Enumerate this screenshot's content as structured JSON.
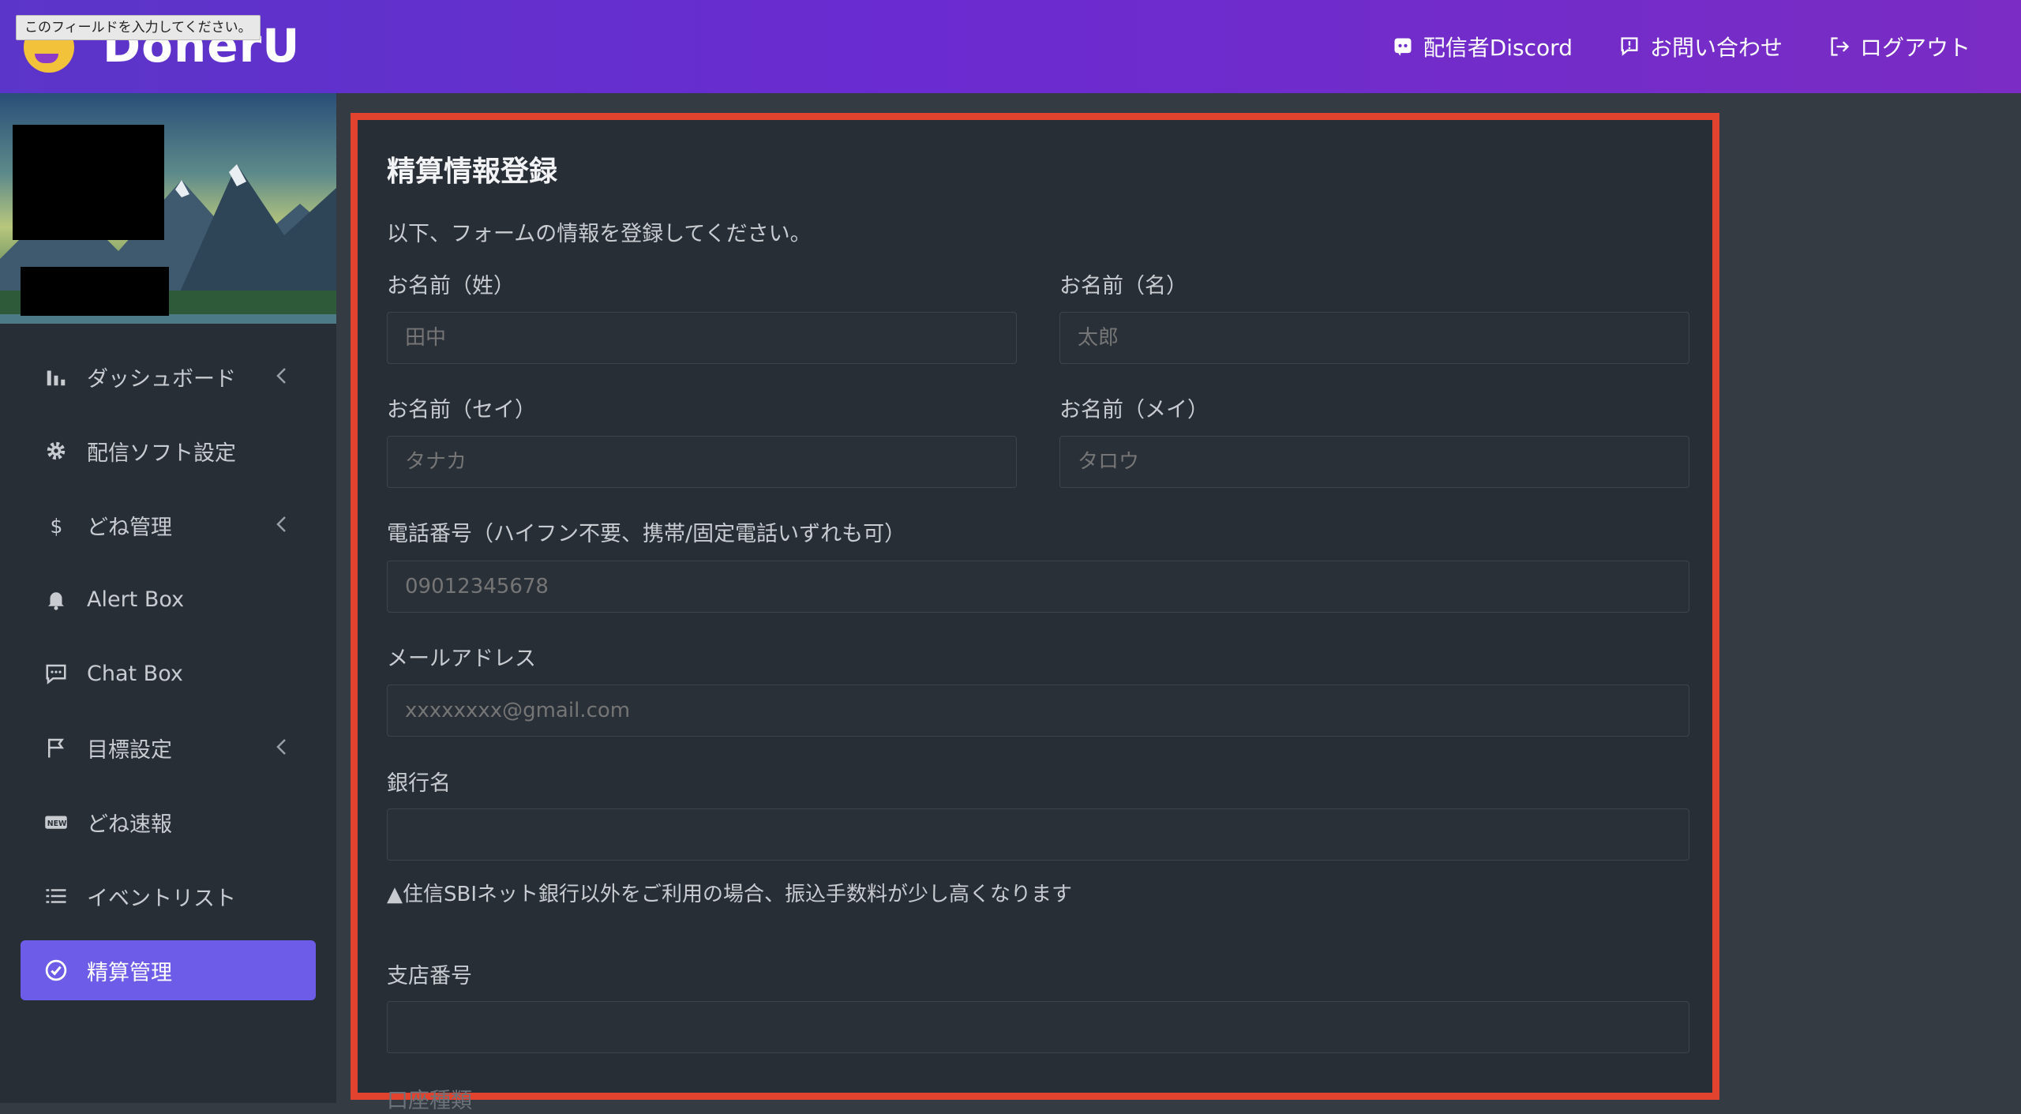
{
  "tooltip": "このフィールドを入力してください。",
  "brand": {
    "name": "DonerU"
  },
  "header_nav": [
    {
      "label": "配信者Discord",
      "icon": "discord-icon"
    },
    {
      "label": "お問い合わせ",
      "icon": "chat-alert-icon"
    },
    {
      "label": "ログアウト",
      "icon": "logout-icon"
    }
  ],
  "sidebar": {
    "items": [
      {
        "label": "ダッシュボード",
        "icon": "bar-chart-icon",
        "chevron": true
      },
      {
        "label": "配信ソフト設定",
        "icon": "gear-icon",
        "chevron": false
      },
      {
        "label": "どね管理",
        "icon": "dollar-icon",
        "chevron": true
      },
      {
        "label": "Alert Box",
        "icon": "bell-icon",
        "chevron": false
      },
      {
        "label": "Chat Box",
        "icon": "chat-icon",
        "chevron": false
      },
      {
        "label": "目標設定",
        "icon": "flag-icon",
        "chevron": true
      },
      {
        "label": "どね速報",
        "icon": "new-badge-icon",
        "chevron": false
      },
      {
        "label": "イベントリスト",
        "icon": "list-icon",
        "chevron": false
      },
      {
        "label": "精算管理",
        "icon": "check-circle-icon",
        "chevron": false,
        "active": true
      }
    ]
  },
  "form": {
    "title": "精算情報登録",
    "subtitle": "以下、フォームの情報を登録してください。",
    "last_name": {
      "label": "お名前（姓）",
      "placeholder": "田中"
    },
    "first_name": {
      "label": "お名前（名）",
      "placeholder": "太郎"
    },
    "last_name_kana": {
      "label": "お名前（セイ）",
      "placeholder": "タナカ"
    },
    "first_name_kana": {
      "label": "お名前（メイ）",
      "placeholder": "タロウ"
    },
    "phone": {
      "label": "電話番号（ハイフン不要、携帯/固定電話いずれも可）",
      "placeholder": "09012345678"
    },
    "email": {
      "label": "メールアドレス",
      "placeholder": "xxxxxxxx@gmail.com"
    },
    "bank": {
      "label": "銀行名",
      "placeholder": ""
    },
    "bank_note": "▲住信SBIネット銀行以外をご利用の場合、振込手数料が少し高くなります",
    "branch": {
      "label": "支店番号",
      "placeholder": ""
    },
    "next_label": "口座種類"
  },
  "colors": {
    "accent": "#6c5ce7",
    "highlight_border": "#e2432e"
  }
}
